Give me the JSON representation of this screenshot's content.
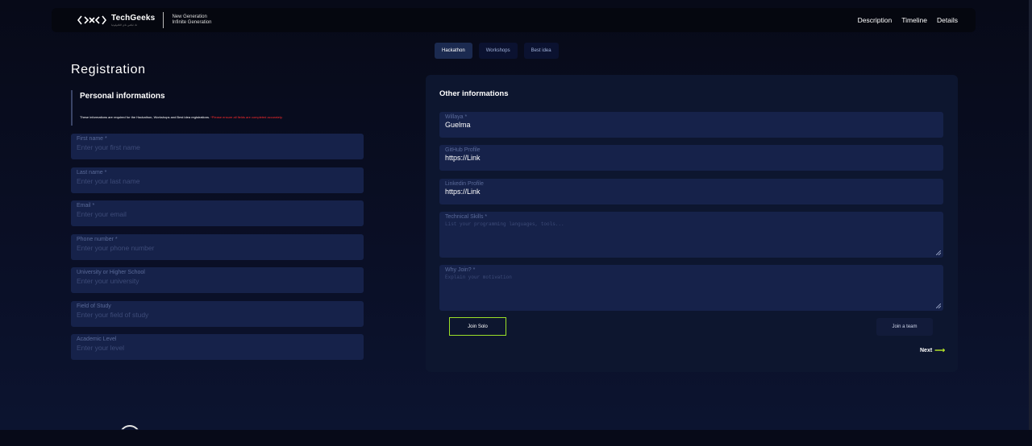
{
  "brand": {
    "name": "TechGeeks",
    "subtitle": "تك غيكس نادي التكنولوجيا",
    "tagline_line1": "New Generation",
    "tagline_line2": "Infinite Generation"
  },
  "nav": {
    "links": [
      "Description",
      "Timeline",
      "Details"
    ]
  },
  "tabs": [
    {
      "label": "Hackathon",
      "active": true
    },
    {
      "label": "Workshops",
      "active": false
    },
    {
      "label": "Best idea",
      "active": false
    }
  ],
  "registration": {
    "title": "Registration",
    "section_title": "Personal informations",
    "note": "These informations are required for the Hackathon, Workshops and Best idea registrations.",
    "warning": "*Please ensure all fields are completed accurately."
  },
  "personal_fields": [
    {
      "label": "First name *",
      "placeholder": "Enter your first name",
      "value": ""
    },
    {
      "label": "Last name *",
      "placeholder": "Enter your last name",
      "value": ""
    },
    {
      "label": "Email *",
      "placeholder": "Enter your email",
      "value": ""
    },
    {
      "label": "Phone number *",
      "placeholder": "Enter your phone number",
      "value": ""
    },
    {
      "label": "University or Higher School",
      "placeholder": "Enter your university",
      "value": ""
    },
    {
      "label": "Field of Study",
      "placeholder": "Enter your field of study",
      "value": ""
    },
    {
      "label": "Academic Level",
      "placeholder": "Enter your level",
      "value": ""
    }
  ],
  "other": {
    "title": "Other informations",
    "wilaya": {
      "label": "Willaya *",
      "value": "Guelma"
    },
    "github": {
      "label": "GitHub Profile",
      "value": "https://Link"
    },
    "linkedin": {
      "label": "Linkedin Profile",
      "value": "https://Link"
    },
    "skills": {
      "label": "Technical Skills *",
      "placeholder": "List your programming languages, tools..."
    },
    "why": {
      "label": "Why Join? *",
      "placeholder": "Explain your motivation"
    },
    "join_solo": "Join Solo",
    "join_team": "Join a team",
    "next": "Next"
  },
  "colors": {
    "background": "#070a18",
    "field": "#16224a",
    "card": "#0d162f",
    "accent_green": "#9be028",
    "warning_red": "#ff2b2b"
  }
}
